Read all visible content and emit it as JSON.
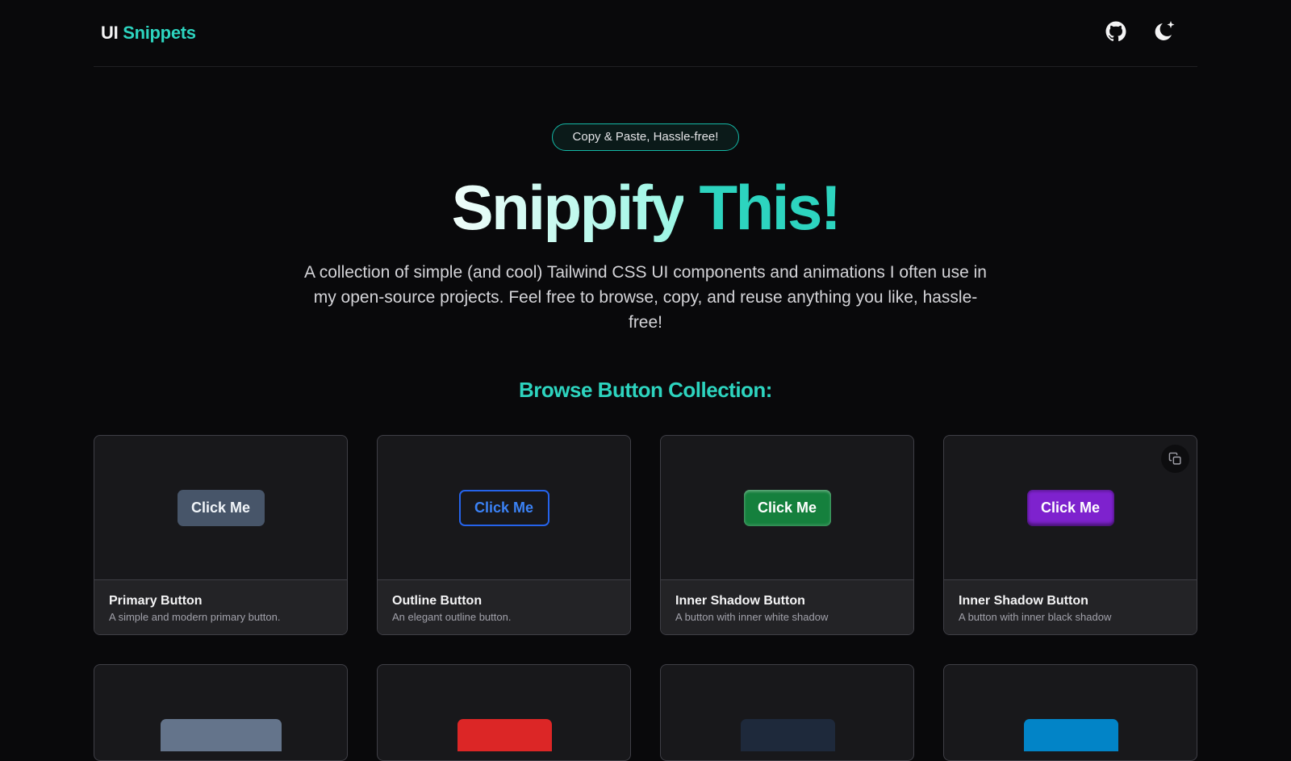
{
  "header": {
    "logo_part1": "UI",
    "logo_part2": "Snippets",
    "github_icon": "github-icon",
    "theme_icon": "moon-stars-icon"
  },
  "hero": {
    "badge": "Copy & Paste, Hassle-free!",
    "title_part1": "Snippify",
    "title_part2": "This!",
    "description": "A collection of simple (and cool) Tailwind CSS UI components and animations I often use in my open-source projects. Feel free to browse, copy, and reuse anything you like, hassle-free!"
  },
  "section": {
    "title": "Browse Button Collection:"
  },
  "cards": [
    {
      "name": "Primary Button",
      "description": "A simple and modern primary button.",
      "button_label": "Click Me"
    },
    {
      "name": "Outline Button",
      "description": "An elegant outline button.",
      "button_label": "Click Me"
    },
    {
      "name": "Inner Shadow Button",
      "description": "A button with inner white shadow",
      "button_label": "Click Me"
    },
    {
      "name": "Inner Shadow Button",
      "description": "A button with inner black shadow",
      "button_label": "Click Me"
    }
  ],
  "partial_cards": [
    {
      "button_color": "#64748b"
    },
    {
      "button_color": "#dc2626"
    },
    {
      "button_color": "#1e293b"
    },
    {
      "button_color": "#0284c7"
    }
  ],
  "colors": {
    "accent": "#2dd4bf",
    "background": "#09090b",
    "card": "#18181b"
  }
}
